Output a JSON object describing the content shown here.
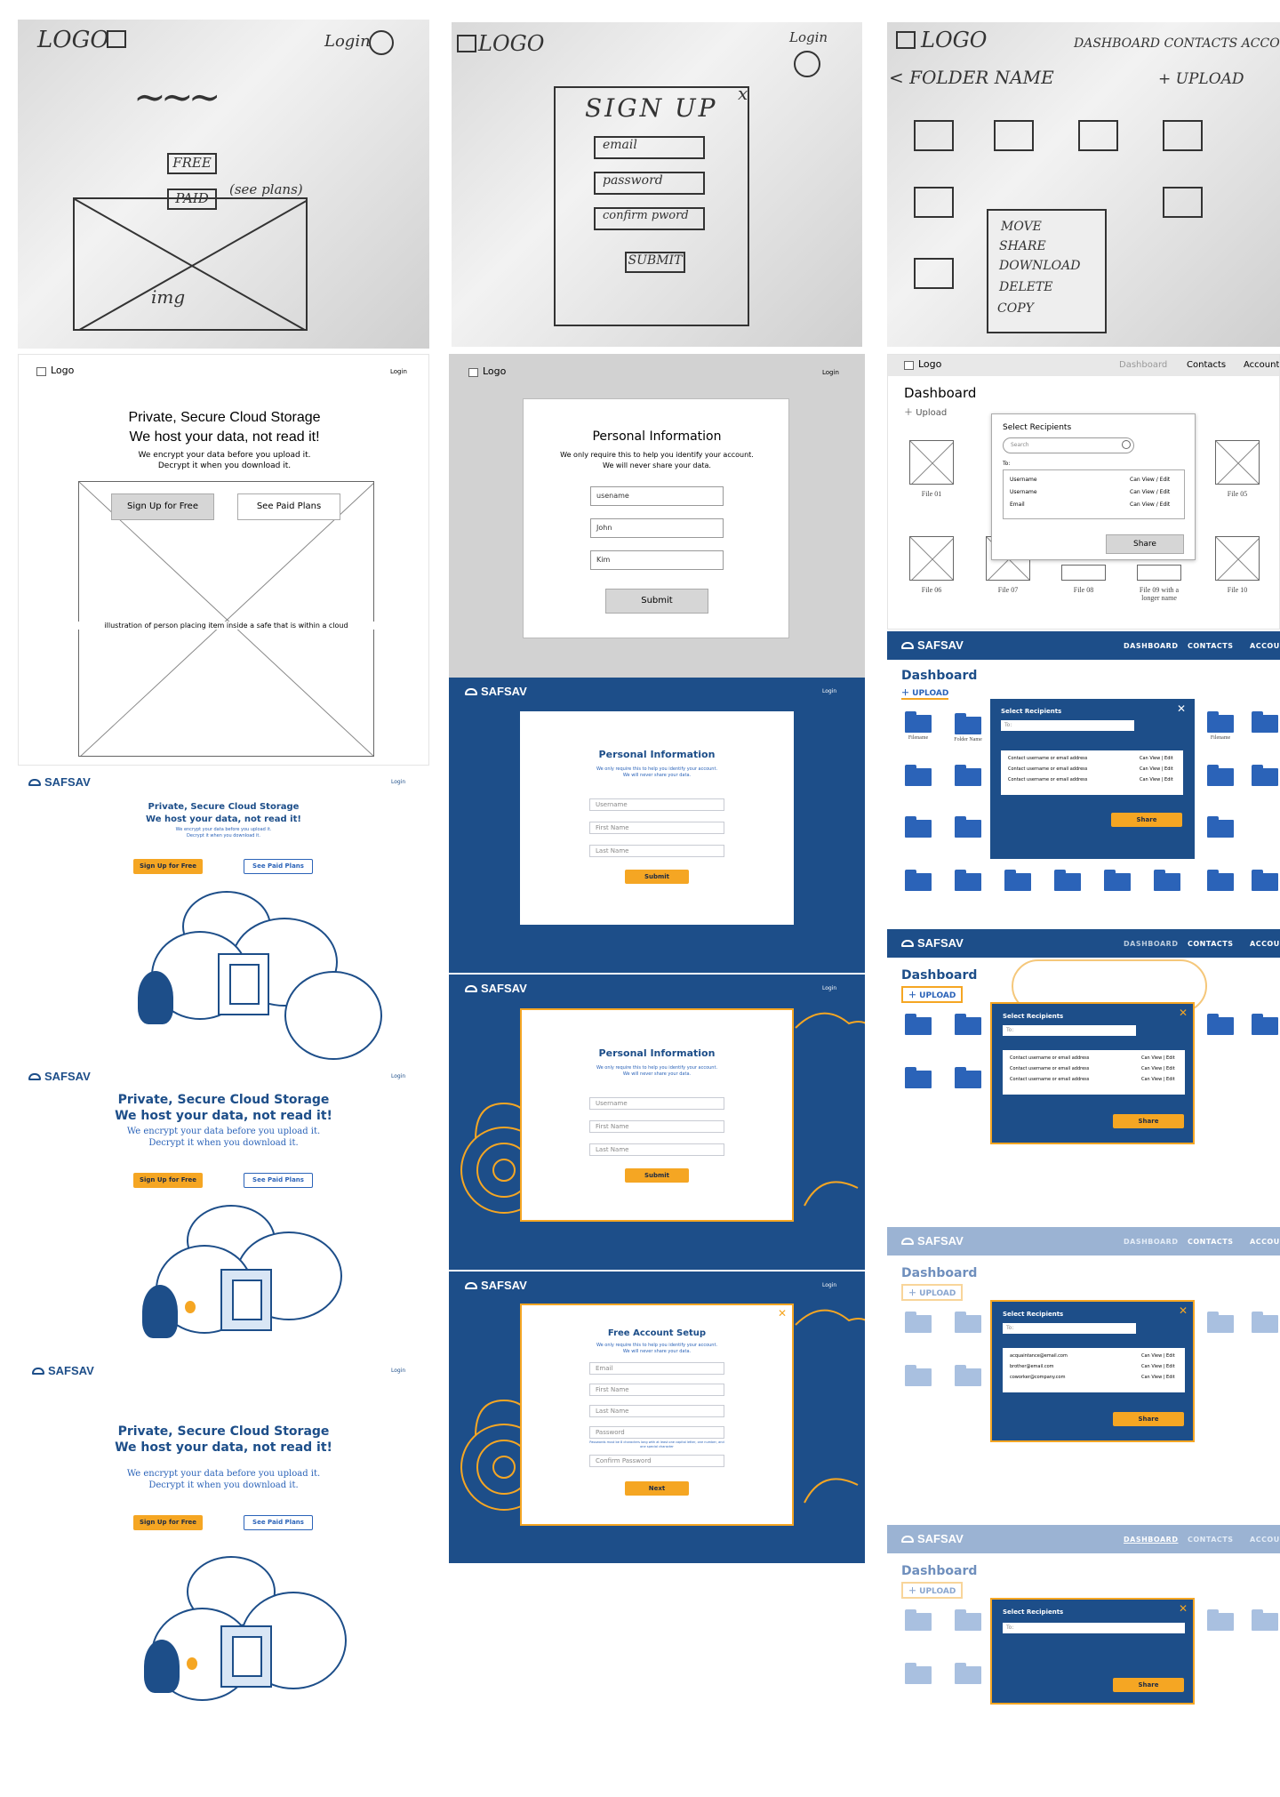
{
  "sketches": {
    "landing": {
      "logo": "LOGO",
      "login": "Login",
      "wave": "~~~",
      "free": "FREE",
      "paid": "PAID",
      "see_plans": "(see plans)",
      "img": "img"
    },
    "signup": {
      "logo": "LOGO",
      "login": "Login",
      "title": "SIGN UP",
      "close": "x",
      "email": "email",
      "password": "password",
      "confirm": "confirm pword",
      "submit": "SUBMIT"
    },
    "dashboard": {
      "logo": "LOGO",
      "nav": "DASHBOARD CONTACTS ACCOUNT",
      "back": "< FOLDER NAME",
      "upload": "+ UPLOAD",
      "menu": [
        "MOVE",
        "SHARE",
        "DOWNLOAD",
        "DELETE",
        "COPY"
      ]
    }
  },
  "wf_landing": {
    "logo": "Logo",
    "login": "Login",
    "title1": "Private, Secure Cloud Storage",
    "title2": "We host your data, not read it!",
    "sub1": "We encrypt your data before you upload it.",
    "sub2": "Decrypt it when you download it.",
    "btn_free": "Sign Up for Free",
    "btn_paid": "See Paid Plans",
    "illustration": "illustration of person placing item inside a safe that is within a cloud"
  },
  "wf_personal": {
    "logo": "Logo",
    "login": "Login",
    "title": "Personal Information",
    "sub1": "We only require this to help you identify your account.",
    "sub2": "We will never share your data.",
    "f1": "usename",
    "f2": "John",
    "f3": "Kim",
    "submit": "Submit"
  },
  "wf_dashboard": {
    "logo": "Logo",
    "nav": [
      "Dashboard",
      "Contacts",
      "Account"
    ],
    "title": "Dashboard",
    "upload": "Upload",
    "modal_title": "Select Recipients",
    "search": "Search",
    "to": "To:",
    "rows": [
      {
        "name": "Username",
        "perm": "Can View / Edit"
      },
      {
        "name": "Username",
        "perm": "Can View / Edit"
      },
      {
        "name": "Email",
        "perm": "Can View / Edit"
      }
    ],
    "share": "Share",
    "files": [
      "File 01",
      "File 05",
      "File 06",
      "File 07",
      "File 08",
      "File 09 with a longer name",
      "File 10"
    ]
  },
  "brand": {
    "name": "SAFSAV",
    "login": "Login",
    "accent": "#f5a623",
    "navy": "#1d4e89",
    "blue": "#2b63b8"
  },
  "hifi_landing": {
    "title1": "Private, Secure Cloud Storage",
    "title2": "We host your data, not read it!",
    "sub1": "We encrypt your data before you upload it.",
    "sub2": "Decrypt it when you download it.",
    "btn_free": "Sign Up for Free",
    "btn_paid": "See Paid Plans"
  },
  "hifi_personal": {
    "title": "Personal Information",
    "sub1": "We only require this to help you identify your account.",
    "sub2": "We will never share your data.",
    "f1": "Username",
    "f2": "First Name",
    "f3": "Last Name",
    "submit": "Submit"
  },
  "hifi_free": {
    "title": "Free Account Setup",
    "sub1": "We only require this to help you identify your account.",
    "sub2": "We will never share your data.",
    "fields": [
      "Email",
      "First Name",
      "Last Name",
      "Password",
      "Confirm Password"
    ],
    "hint": "Passwords must be 8 characters long with at least one capital letter, one number, and one special character",
    "next": "Next"
  },
  "hifi_dash": {
    "nav": [
      "DASHBOARD",
      "CONTACTS",
      "ACCOUNT"
    ],
    "title": "Dashboard",
    "upload": "UPLOAD",
    "modal_title": "Select Recipients",
    "to": "To:",
    "contact_placeholder": "Contact username or email address",
    "perm": "Can View | Edit",
    "share": "Share",
    "emails": [
      "acquaintance@email.com",
      "brother@email.com",
      "coworker@company.com"
    ],
    "filename": "Filename",
    "folder": "Folder Name"
  }
}
